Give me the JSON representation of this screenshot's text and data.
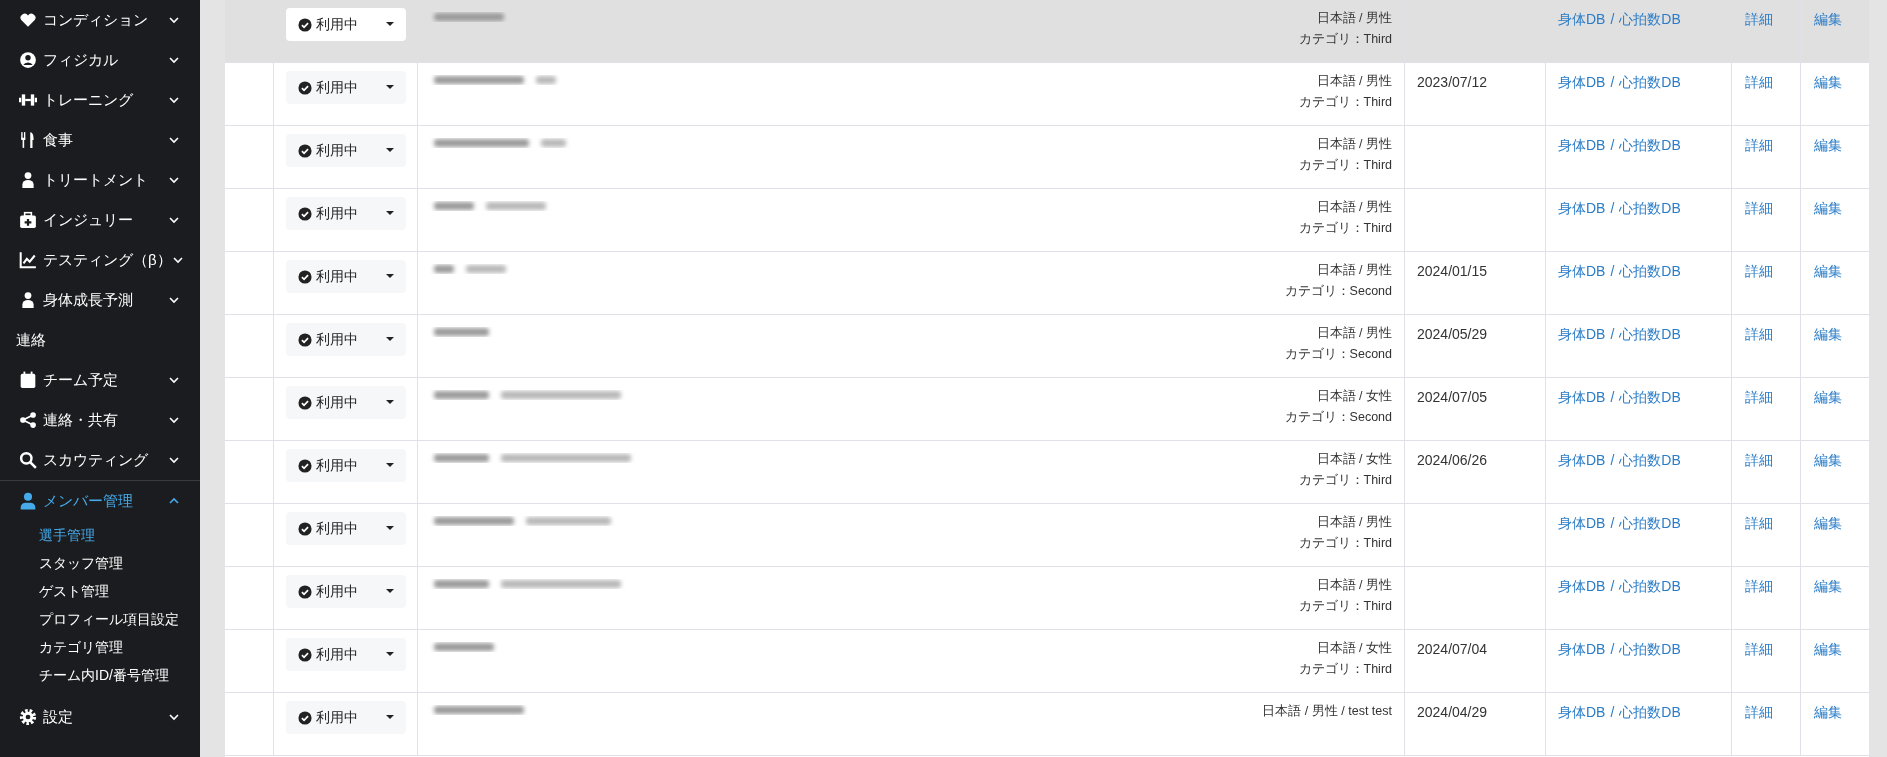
{
  "sidebar": {
    "items": [
      {
        "label": "コンディション",
        "kind": "menu",
        "expanded": false,
        "selected": false
      },
      {
        "label": "フィジカル",
        "kind": "menu",
        "expanded": false,
        "selected": false
      },
      {
        "label": "トレーニング",
        "kind": "menu",
        "expanded": false,
        "selected": false
      },
      {
        "label": "食事",
        "kind": "menu",
        "expanded": false,
        "selected": false
      },
      {
        "label": "トリートメント",
        "kind": "menu",
        "expanded": false,
        "selected": false
      },
      {
        "label": "インジュリー",
        "kind": "menu",
        "expanded": false,
        "selected": false
      },
      {
        "label": "テスティング（β）",
        "kind": "menu",
        "expanded": false,
        "selected": false
      },
      {
        "label": "身体成長予測",
        "kind": "menu",
        "expanded": false,
        "selected": false
      },
      {
        "label": "連絡",
        "kind": "heading"
      },
      {
        "label": "チーム予定",
        "kind": "menu",
        "expanded": false,
        "selected": false
      },
      {
        "label": "連絡・共有",
        "kind": "menu",
        "expanded": false,
        "selected": false
      },
      {
        "label": "スカウティング",
        "kind": "menu",
        "expanded": false,
        "selected": false
      },
      {
        "label": "メンバー管理",
        "kind": "menu",
        "expanded": true,
        "selected": true,
        "children": [
          {
            "label": "選手管理",
            "selected": true
          },
          {
            "label": "スタッフ管理",
            "selected": false
          },
          {
            "label": "ゲスト管理",
            "selected": false
          },
          {
            "label": "プロフィール項目設定",
            "selected": false
          },
          {
            "label": "カテゴリ管理",
            "selected": false
          },
          {
            "label": "チーム内ID/番号管理",
            "selected": false
          }
        ]
      },
      {
        "label": "設定",
        "kind": "menu",
        "expanded": false,
        "selected": false
      }
    ]
  },
  "table": {
    "rows": [
      {
        "highlighted": true,
        "status": "利用中",
        "profile": "日本語 / 男性",
        "category": "カテゴリ：Third",
        "links": [
          "身体DB",
          "/",
          "心拍数DB"
        ],
        "detail": "詳細",
        "edit": "編集"
      },
      {
        "highlighted": false,
        "status": "利用中",
        "profile": "日本語 / 男性",
        "category": "カテゴリ：Third",
        "date": "2023/07/12",
        "links": [
          "身体DB",
          "/",
          "心拍数DB"
        ],
        "detail": "詳細",
        "edit": "編集"
      },
      {
        "highlighted": false,
        "status": "利用中",
        "profile": "日本語 / 男性",
        "category": "カテゴリ：Third",
        "links": [
          "身体DB",
          "/",
          "心拍数DB"
        ],
        "detail": "詳細",
        "edit": "編集"
      },
      {
        "highlighted": false,
        "status": "利用中",
        "profile": "日本語 / 男性",
        "category": "カテゴリ：Third",
        "links": [
          "身体DB",
          "/",
          "心拍数DB"
        ],
        "detail": "詳細",
        "edit": "編集"
      },
      {
        "highlighted": false,
        "status": "利用中",
        "profile": "日本語 / 男性",
        "category": "カテゴリ：Second",
        "date": "2024/01/15",
        "links": [
          "身体DB",
          "/",
          "心拍数DB"
        ],
        "detail": "詳細",
        "edit": "編集"
      },
      {
        "highlighted": false,
        "status": "利用中",
        "profile": "日本語 / 男性",
        "category": "カテゴリ：Second",
        "date": "2024/05/29",
        "links": [
          "身体DB",
          "/",
          "心拍数DB"
        ],
        "detail": "詳細",
        "edit": "編集"
      },
      {
        "highlighted": false,
        "status": "利用中",
        "profile": "日本語 / 女性",
        "category": "カテゴリ：Second",
        "date": "2024/07/05",
        "links": [
          "身体DB",
          "/",
          "心拍数DB"
        ],
        "detail": "詳細",
        "edit": "編集"
      },
      {
        "highlighted": false,
        "status": "利用中",
        "profile": "日本語 / 女性",
        "category": "カテゴリ：Third",
        "date": "2024/06/26",
        "links": [
          "身体DB",
          "/",
          "心拍数DB"
        ],
        "detail": "詳細",
        "edit": "編集"
      },
      {
        "highlighted": false,
        "status": "利用中",
        "profile": "日本語 / 男性",
        "category": "カテゴリ：Third",
        "links": [
          "身体DB",
          "/",
          "心拍数DB"
        ],
        "detail": "詳細",
        "edit": "編集"
      },
      {
        "highlighted": false,
        "status": "利用中",
        "profile": "日本語 / 男性",
        "category": "カテゴリ：Third",
        "links": [
          "身体DB",
          "/",
          "心拍数DB"
        ],
        "detail": "詳細",
        "edit": "編集"
      },
      {
        "highlighted": false,
        "status": "利用中",
        "profile": "日本語 / 女性",
        "category": "カテゴリ：Third",
        "date": "2024/07/04",
        "links": [
          "身体DB",
          "/",
          "心拍数DB"
        ],
        "detail": "詳細",
        "edit": "編集"
      },
      {
        "highlighted": false,
        "status": "利用中",
        "profile": "日本語 / 男性 / test test",
        "date": "2024/04/29",
        "links": [
          "身体DB",
          "/",
          "心拍数DB"
        ],
        "detail": "詳細",
        "edit": "編集"
      }
    ]
  }
}
